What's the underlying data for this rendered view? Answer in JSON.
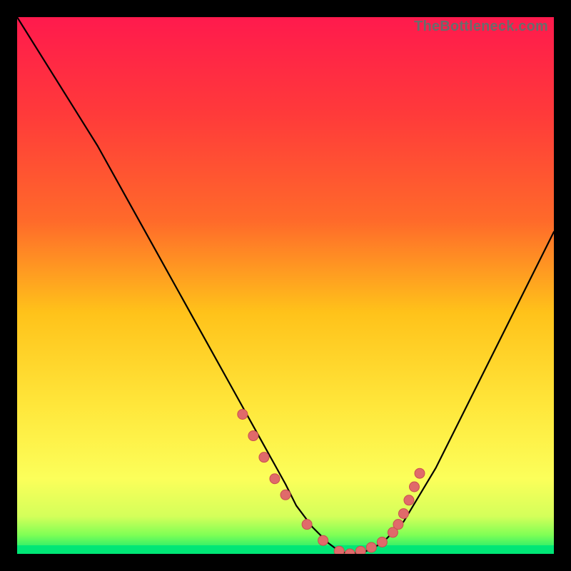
{
  "watermark": "TheBottleneck.com",
  "colors": {
    "bg": "#000000",
    "grad_top": "#ff1a4d",
    "grad_mid_upper": "#ff6a2a",
    "grad_mid": "#ffc21a",
    "grad_mid_lower": "#ffe63a",
    "grad_lower": "#fcff5a",
    "grad_bottom": "#00e676",
    "curve": "#000000",
    "dot_fill": "#e06a6a",
    "dot_stroke": "#c94f4f"
  },
  "chart_data": {
    "type": "line",
    "title": "",
    "xlabel": "",
    "ylabel": "",
    "xlim": [
      0,
      100
    ],
    "ylim": [
      0,
      100
    ],
    "series": [
      {
        "name": "bottleneck-curve",
        "x": [
          0,
          5,
          10,
          15,
          20,
          25,
          30,
          35,
          40,
          45,
          50,
          52,
          55,
          58,
          60,
          62,
          65,
          68,
          72,
          78,
          85,
          92,
          100
        ],
        "y": [
          100,
          92,
          84,
          76,
          67,
          58,
          49,
          40,
          31,
          22,
          13,
          9,
          5,
          2,
          0.5,
          0,
          0.5,
          2,
          6,
          16,
          30,
          44,
          60
        ]
      }
    ],
    "dots": {
      "name": "highlight-dots",
      "x": [
        42,
        44,
        46,
        48,
        50,
        54,
        57,
        60,
        62,
        64,
        66,
        68,
        70,
        71,
        72,
        73,
        74,
        75
      ],
      "y": [
        26,
        22,
        18,
        14,
        11,
        5.5,
        2.5,
        0.5,
        0,
        0.5,
        1.2,
        2.2,
        4,
        5.5,
        7.5,
        10,
        12.5,
        15
      ]
    }
  }
}
